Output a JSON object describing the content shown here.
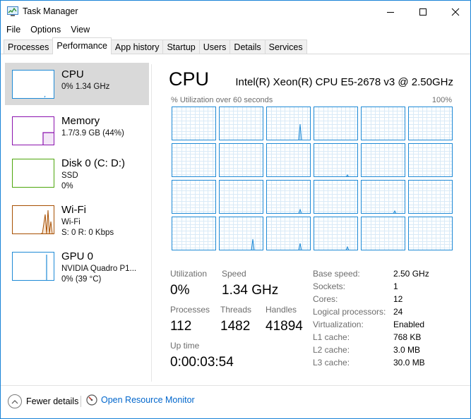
{
  "window": {
    "title": "Task Manager"
  },
  "menu": [
    "File",
    "Options",
    "View"
  ],
  "tabs": [
    {
      "label": "Processes"
    },
    {
      "label": "Performance",
      "active": true
    },
    {
      "label": "App history"
    },
    {
      "label": "Startup"
    },
    {
      "label": "Users"
    },
    {
      "label": "Details"
    },
    {
      "label": "Services"
    }
  ],
  "sidebar": {
    "items": [
      {
        "title": "CPU",
        "lines": [
          "0%  1.34 GHz"
        ],
        "color": "#1e8ad6",
        "selected": true
      },
      {
        "title": "Memory",
        "lines": [
          "1.7/3.9 GB (44%)"
        ],
        "color": "#8b12ae"
      },
      {
        "title": "Disk 0 (C: D:)",
        "lines": [
          "SSD",
          "0%"
        ],
        "color": "#4da60c"
      },
      {
        "title": "Wi-Fi",
        "lines": [
          "Wi-Fi",
          "S: 0  R: 0 Kbps"
        ],
        "color": "#a74f01"
      },
      {
        "title": "GPU 0",
        "lines": [
          "NVIDIA Quadro P1...",
          "0%  (39 °C)"
        ],
        "color": "#1e8ad6"
      }
    ]
  },
  "main": {
    "title": "CPU",
    "model": "Intel(R) Xeon(R) CPU E5-2678 v3 @ 2.50GHz",
    "graph_label": "% Utilization over 60 seconds",
    "graph_max": "100%",
    "core_count": 24,
    "stats": {
      "utilization_label": "Utilization",
      "utilization": "0%",
      "speed_label": "Speed",
      "speed": "1.34 GHz",
      "processes_label": "Processes",
      "processes": "112",
      "threads_label": "Threads",
      "threads": "1482",
      "handles_label": "Handles",
      "handles": "41894",
      "uptime_label": "Up time",
      "uptime": "0:00:03:54"
    },
    "specs": [
      {
        "key": "Base speed:",
        "value": "2.50 GHz"
      },
      {
        "key": "Sockets:",
        "value": "1"
      },
      {
        "key": "Cores:",
        "value": "12"
      },
      {
        "key": "Logical processors:",
        "value": "24"
      },
      {
        "key": "Virtualization:",
        "value": "Enabled"
      },
      {
        "key": "L1 cache:",
        "value": "768 KB"
      },
      {
        "key": "L2 cache:",
        "value": "3.0 MB"
      },
      {
        "key": "L3 cache:",
        "value": "30.0 MB"
      }
    ]
  },
  "footer": {
    "fewer_details": "Fewer details",
    "open_resource_monitor": "Open Resource Monitor"
  },
  "colors": {
    "accent": "#1e8ad6",
    "selected_bg": "#d9d9d9",
    "link": "#0066cc"
  }
}
